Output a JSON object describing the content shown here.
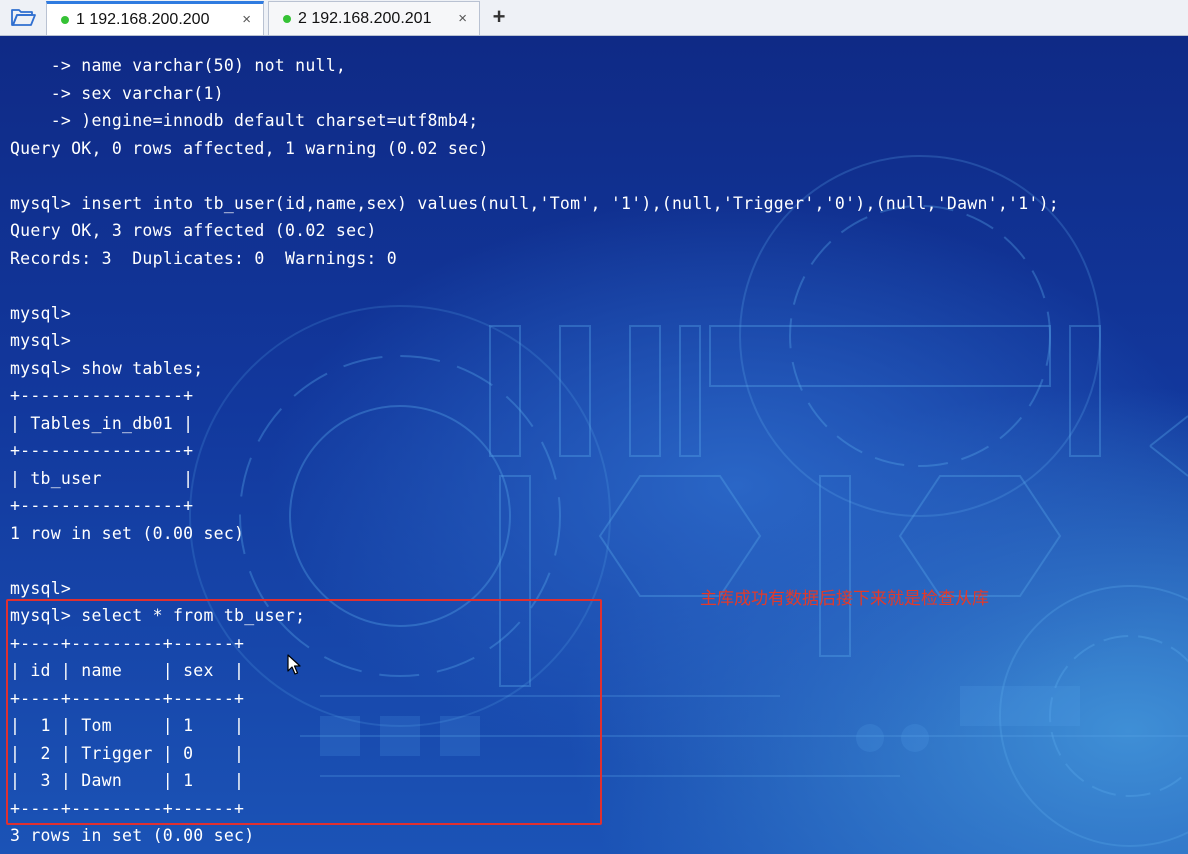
{
  "tabs": [
    {
      "label": "1 192.168.200.200",
      "close": "×",
      "active": true
    },
    {
      "label": "2 192.168.200.201",
      "close": "×",
      "active": false
    }
  ],
  "add_tab": "+",
  "colors": {
    "terminal_text": "#ffffff",
    "highlight": "#e03030",
    "annotation": "#e23a2a",
    "status_dot": "#35c235",
    "active_tab_accent": "#2f7be0"
  },
  "terminal": {
    "lines": [
      "    -> name varchar(50) not null,",
      "    -> sex varchar(1)",
      "    -> )engine=innodb default charset=utf8mb4;",
      "Query OK, 0 rows affected, 1 warning (0.02 sec)",
      "",
      "mysql> insert into tb_user(id,name,sex) values(null,'Tom', '1'),(null,'Trigger','0'),(null,'Dawn','1');",
      "Query OK, 3 rows affected (0.02 sec)",
      "Records: 3  Duplicates: 0  Warnings: 0",
      "",
      "mysql>",
      "mysql>",
      "mysql> show tables;",
      "+----------------+",
      "| Tables_in_db01 |",
      "+----------------+",
      "| tb_user        |",
      "+----------------+",
      "1 row in set (0.00 sec)",
      "",
      "mysql>",
      "mysql> select * from tb_user;",
      "+----+---------+------+",
      "| id | name    | sex  |",
      "+----+---------+------+",
      "|  1 | Tom     | 1    |",
      "|  2 | Trigger | 0    |",
      "|  3 | Dawn    | 1    |",
      "+----+---------+------+",
      "3 rows in set (0.00 sec)"
    ]
  },
  "annotation": "主库成功有数据后接下来就是检查从库"
}
